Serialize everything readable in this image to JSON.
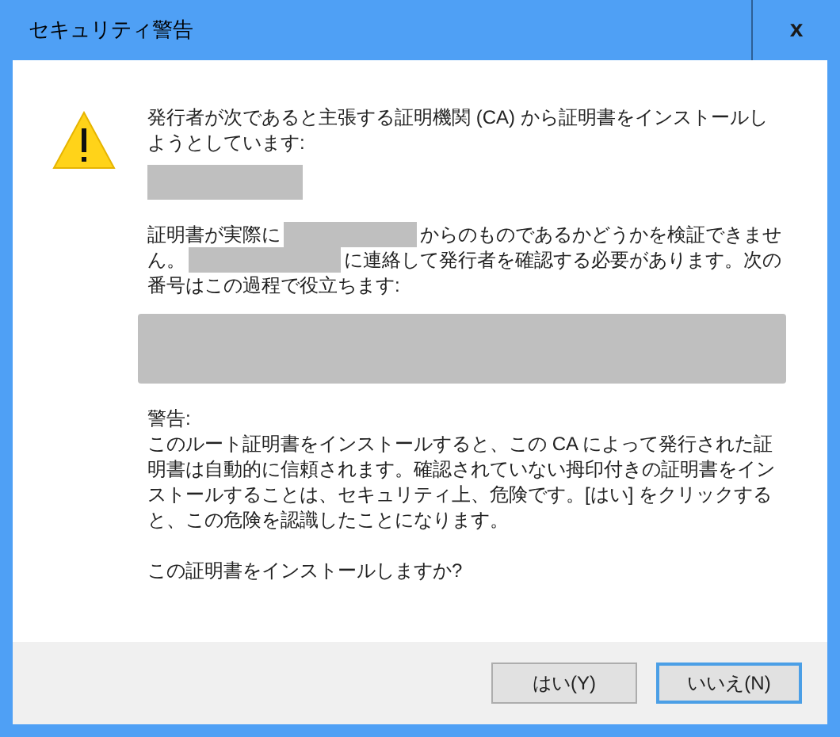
{
  "window": {
    "title": "セキュリティ警告",
    "close": "x"
  },
  "intro": "発行者が次であると主張する証明機関 (CA) から証明書をインストールしようとしています:",
  "verify_lines": [
    [
      {
        "kind": "text",
        "text": "証明書が実際に"
      },
      {
        "kind": "redacted"
      },
      {
        "kind": "text",
        "text": "からのものであるかどうかを検証できませ"
      }
    ],
    [
      {
        "kind": "text",
        "text": "ん。"
      },
      {
        "kind": "redacted"
      },
      {
        "kind": "text",
        "text": "に連絡して発行者を確認する必要があります。次の"
      }
    ],
    [
      {
        "kind": "text",
        "text": "番号はこの過程で役立ちます:"
      }
    ]
  ],
  "warning_heading": "警告:",
  "warning": "このルート証明書をインストールすると、この CA によって発行された証明書は自動的に信頼されます。確認されていない拇印付きの証明書をインストールすることは、セキュリティ上、危険です。[はい] をクリックすると、この危険を認識したことになります。",
  "question": "この証明書をインストールしますか?",
  "buttons": [
    {
      "label": "はい(Y)",
      "selected": false
    },
    {
      "label": "いいえ(N)",
      "selected": true
    }
  ]
}
